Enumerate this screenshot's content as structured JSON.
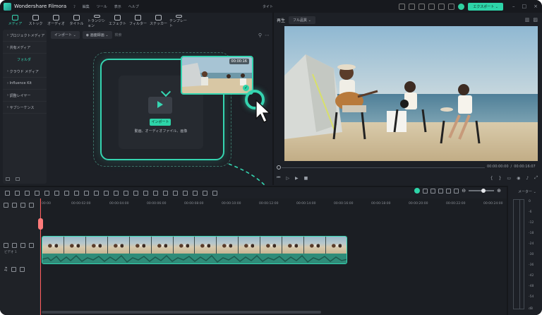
{
  "app": {
    "name": "Wondershare Filmora",
    "doc_title": "タイト",
    "menu": [
      "ﾌ",
      "編集",
      "ツール",
      "表示",
      "ヘルプ"
    ],
    "export_label": "エクスポート ⌄"
  },
  "toolbar": {
    "items": [
      "メディア",
      "ストック",
      "オーディオ",
      "タイトル",
      "トランジション",
      "エフェクト",
      "フィルター",
      "ステッカー",
      "テンプレート"
    ]
  },
  "sidebar": {
    "items": [
      "プロジェクトメディア",
      "共有メディア",
      "フォルダ",
      "クラウド メディア",
      "Influence Kit",
      "調整レイヤー",
      "サブシーケンス"
    ]
  },
  "media": {
    "import_label": "インポート ⌄",
    "sort_label": "◉ 画面録画 ⌄",
    "search_placeholder": "検索",
    "drop_import": "インポート",
    "drop_text": "動画、オーディオファイル、画像"
  },
  "thumbnail": {
    "duration": "00:00:16"
  },
  "preview": {
    "player_label": "再生",
    "quality_label": "フル品質 ⌄",
    "current_time": "00:00:00:00",
    "total_time": "00:00:16:07"
  },
  "timeline": {
    "ruler": [
      "00:00",
      "00:00:02:00",
      "00:00:04:00",
      "00:00:06:00",
      "00:00:08:00",
      "00:00:10:00",
      "00:00:12:00",
      "00:00:14:00",
      "00:00:16:00",
      "00:00:18:00",
      "00:00:20:00",
      "00:00:22:00",
      "00:00:24:00"
    ],
    "video_track_label": "ビデオ 1",
    "meter_label": "メーター ⌄",
    "meter_scale": [
      "0",
      "-6",
      "-12",
      "-18",
      "-24",
      "-30",
      "-36",
      "-42",
      "-48",
      "-54",
      "dB"
    ]
  }
}
